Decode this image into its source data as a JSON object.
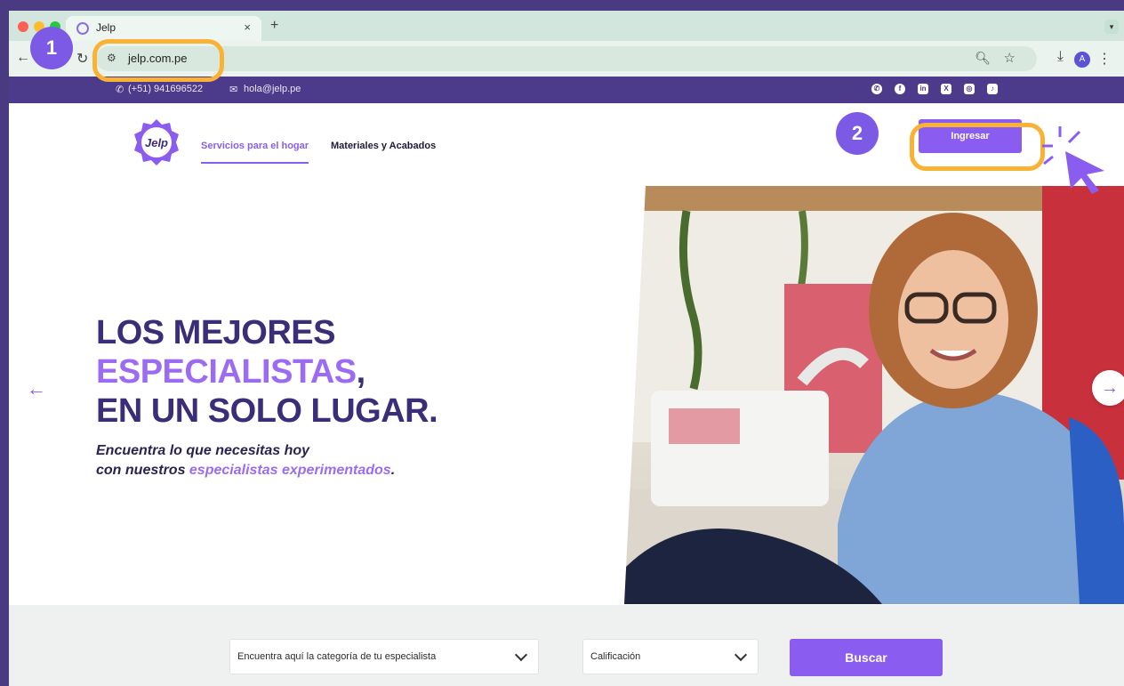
{
  "browser": {
    "tab_title": "Jelp",
    "tab_close": "×",
    "new_tab": "+",
    "url": "jelp.com.pe",
    "profile_initial": "A"
  },
  "site": {
    "contact_phone": "(+51) 941696522",
    "contact_email": "hola@jelp.pe",
    "logo_text": "Jelp",
    "nav": {
      "services": "Servicios para el hogar",
      "materials": "Materiales y Acabados"
    },
    "login_label": "Ingresar"
  },
  "hero": {
    "line1": "LOS MEJORES",
    "line2_accent": "ESPECIALISTAS",
    "line2_suffix": ",",
    "line3": "EN UN SOLO LUGAR.",
    "sub1": "Encuentra lo que necesitas hoy",
    "sub2_prefix": "con nuestros ",
    "sub2_accent": "especialistas experimentados",
    "sub2_suffix": "."
  },
  "search": {
    "category_placeholder": "Encuentra aquí la categoría de tu especialista",
    "rating_placeholder": "Calificación",
    "button_label": "Buscar"
  },
  "annotations": {
    "step1": "1",
    "step2": "2",
    "highlight_color": "#f9b233",
    "badge_color": "#7c5ae6"
  },
  "colors": {
    "brand_purple": "#8a5cf0",
    "dark_purple": "#3c2d78",
    "topbar": "#4c3a8a"
  }
}
